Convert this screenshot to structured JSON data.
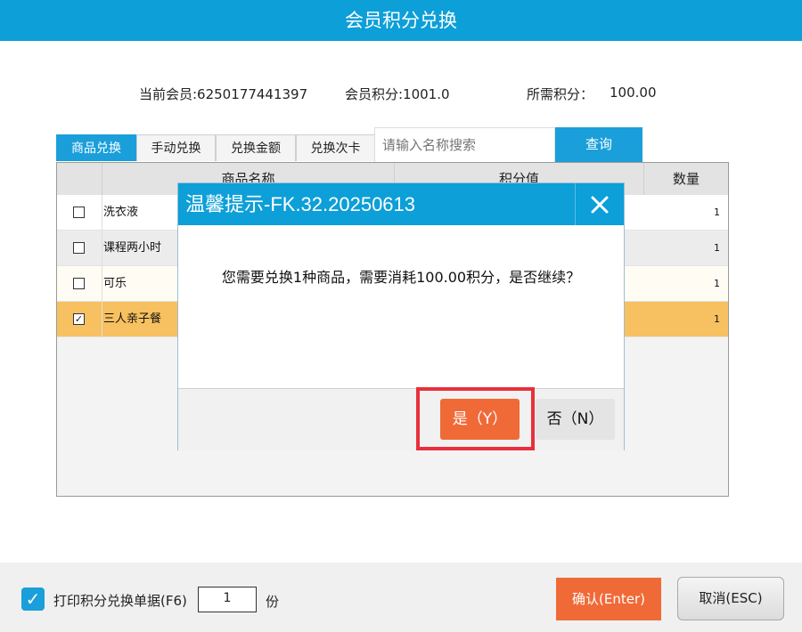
{
  "window": {
    "title": "会员积分兑换"
  },
  "info": {
    "member": "当前会员:6250177441397",
    "points": "会员积分:1001.0",
    "required_label": "所需积分：",
    "required_value": "100.00"
  },
  "tabs": [
    {
      "label": "商品兑换",
      "active": true
    },
    {
      "label": "手动兑换",
      "active": false
    },
    {
      "label": "兑换金额",
      "active": false
    },
    {
      "label": "兑换次卡",
      "active": false
    }
  ],
  "search": {
    "placeholder": "请输入名称搜索",
    "button": "查询"
  },
  "table": {
    "headers": [
      "商品名称",
      "积分值",
      "数量"
    ],
    "rows": [
      {
        "name": "洗衣液",
        "qty": "1",
        "checked": false
      },
      {
        "name": "课程两小时",
        "qty": "1",
        "checked": false
      },
      {
        "name": "可乐",
        "qty": "1",
        "checked": false
      },
      {
        "name": "三人亲子餐",
        "qty": "1",
        "checked": true
      }
    ]
  },
  "footer": {
    "print_label": "打印积分兑换单据(F6)",
    "copies": "1",
    "copies_unit": "份",
    "confirm": "确认(Enter)",
    "cancel": "取消(ESC)"
  },
  "dialog": {
    "title": "温馨提示-FK.32.20250613",
    "message": "您需要兑换1种商品，需要消耗100.00积分，是否继续？",
    "yes": "是（Y）",
    "no": "否（N）"
  },
  "colors": {
    "accent": "#0d9fd8",
    "primary_button": "#f06a38",
    "selected_row": "#f7c060",
    "highlight_box": "#e8303a"
  }
}
